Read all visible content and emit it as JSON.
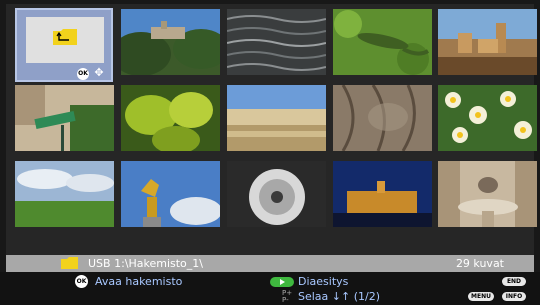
{
  "folder_tile": {
    "ok_badge": "OK",
    "nav_symbol": "✥"
  },
  "status_bar": {
    "path": "USB 1:\\Hakemisto_1\\",
    "count": "29 kuvat"
  },
  "help_bar": {
    "ok_badge": "OK",
    "open_folder": "Avaa hakemisto",
    "slideshow": "Diaesitys",
    "page_icon": "P+\nP-",
    "browse": "Selaa ↓↑ (1/2)",
    "end_key": "END",
    "menu_key": "MENU",
    "info_key": "INFO"
  },
  "colors": {
    "folder_yellow": "#f2d21c",
    "slideshow_green": "#3fb83f",
    "hint_blue": "#a9c8ff"
  },
  "thumbnails": [
    {
      "name": "castle-hill"
    },
    {
      "name": "water-ripples"
    },
    {
      "name": "lizard"
    },
    {
      "name": "hill-town"
    },
    {
      "name": "street-sign"
    },
    {
      "name": "green-leaves"
    },
    {
      "name": "riverside-buildings"
    },
    {
      "name": "elephant-skin"
    },
    {
      "name": "daffodils"
    },
    {
      "name": "cloudy-field"
    },
    {
      "name": "golden-statue"
    },
    {
      "name": "dandelion-clock"
    },
    {
      "name": "night-castle"
    },
    {
      "name": "fountain"
    }
  ]
}
